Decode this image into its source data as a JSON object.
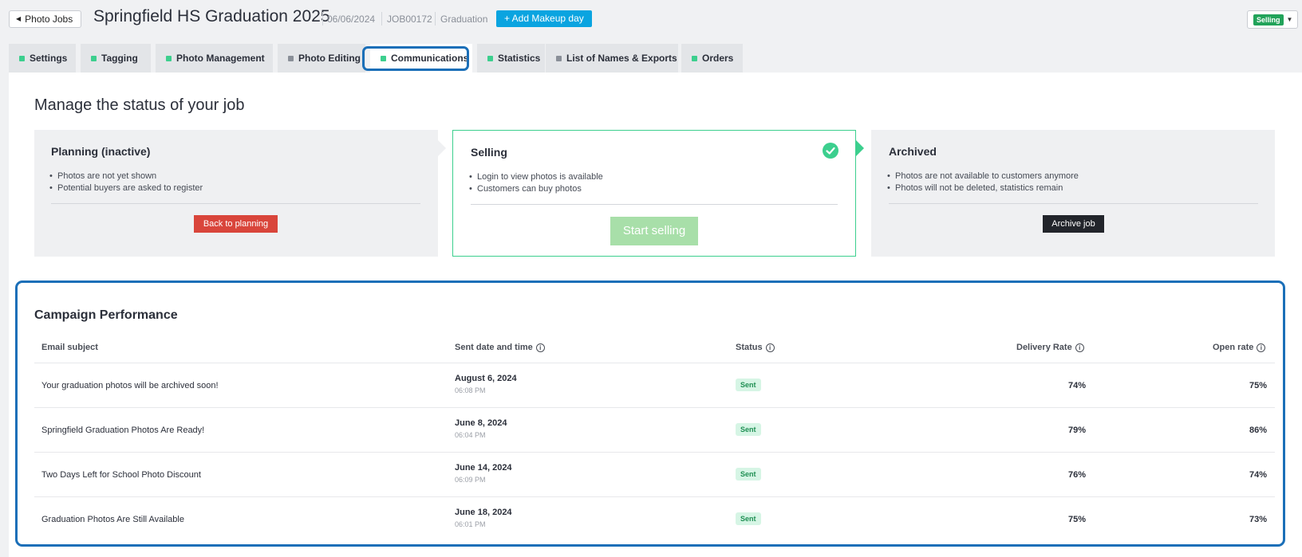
{
  "header": {
    "back_label": "Photo Jobs",
    "job_title": "Springfield HS Graduation 2025",
    "job_date": "06/06/2024",
    "job_code": "JOB00172",
    "job_type": "Graduation",
    "makeup_label": "+ Add Makeup day",
    "status_value": "Selling"
  },
  "tabs": [
    {
      "label": "Settings",
      "dot": "#3ccf8e"
    },
    {
      "label": "Tagging",
      "dot": "#3ccf8e"
    },
    {
      "label": "Photo Management",
      "dot": "#3ccf8e"
    },
    {
      "label": "Photo Editing",
      "dot": "#8a8f98"
    },
    {
      "label": "Communications",
      "dot": "#3ccf8e"
    },
    {
      "label": "Statistics",
      "dot": "#3ccf8e"
    },
    {
      "label": "List of Names & Exports",
      "dot": "#8a8f98"
    },
    {
      "label": "Orders",
      "dot": "#3ccf8e"
    }
  ],
  "status_section": {
    "title": "Manage the status of your job",
    "planning": {
      "title": "Planning (inactive)",
      "bullets": [
        "Photos are not yet shown",
        "Potential buyers are asked to register"
      ],
      "button": "Back to planning"
    },
    "selling": {
      "title": "Selling",
      "bullets": [
        "Login to view photos is available",
        "Customers can buy photos"
      ],
      "button": "Start selling"
    },
    "archived": {
      "title": "Archived",
      "bullets": [
        "Photos are not available to customers anymore",
        "Photos will not be deleted, statistics remain"
      ],
      "button": "Archive job"
    }
  },
  "campaign": {
    "title": "Campaign Performance",
    "columns": {
      "subject": "Email subject",
      "sent": "Sent date and time",
      "status": "Status",
      "delivery": "Delivery Rate",
      "open": "Open rate"
    },
    "rows": [
      {
        "subject": "Your graduation photos will be archived soon!",
        "date": "August 6, 2024",
        "time": "06:08 PM",
        "status": "Sent",
        "delivery": "74%",
        "open": "75%"
      },
      {
        "subject": "Springfield Graduation Photos Are Ready!",
        "date": "June 8, 2024",
        "time": "06:04 PM",
        "status": "Sent",
        "delivery": "79%",
        "open": "86%"
      },
      {
        "subject": "Two Days Left for School Photo Discount",
        "date": "June 14, 2024",
        "time": "06:09 PM",
        "status": "Sent",
        "delivery": "76%",
        "open": "74%"
      },
      {
        "subject": "Graduation Photos Are Still Available",
        "date": "June 18, 2024",
        "time": "06:01 PM",
        "status": "Sent",
        "delivery": "75%",
        "open": "73%"
      }
    ]
  },
  "colors": {
    "accent_blue": "#0aa4e0",
    "selling_green": "#3ccf8e",
    "danger_red": "#d9453b",
    "highlight_ring": "#1b6fb8"
  }
}
